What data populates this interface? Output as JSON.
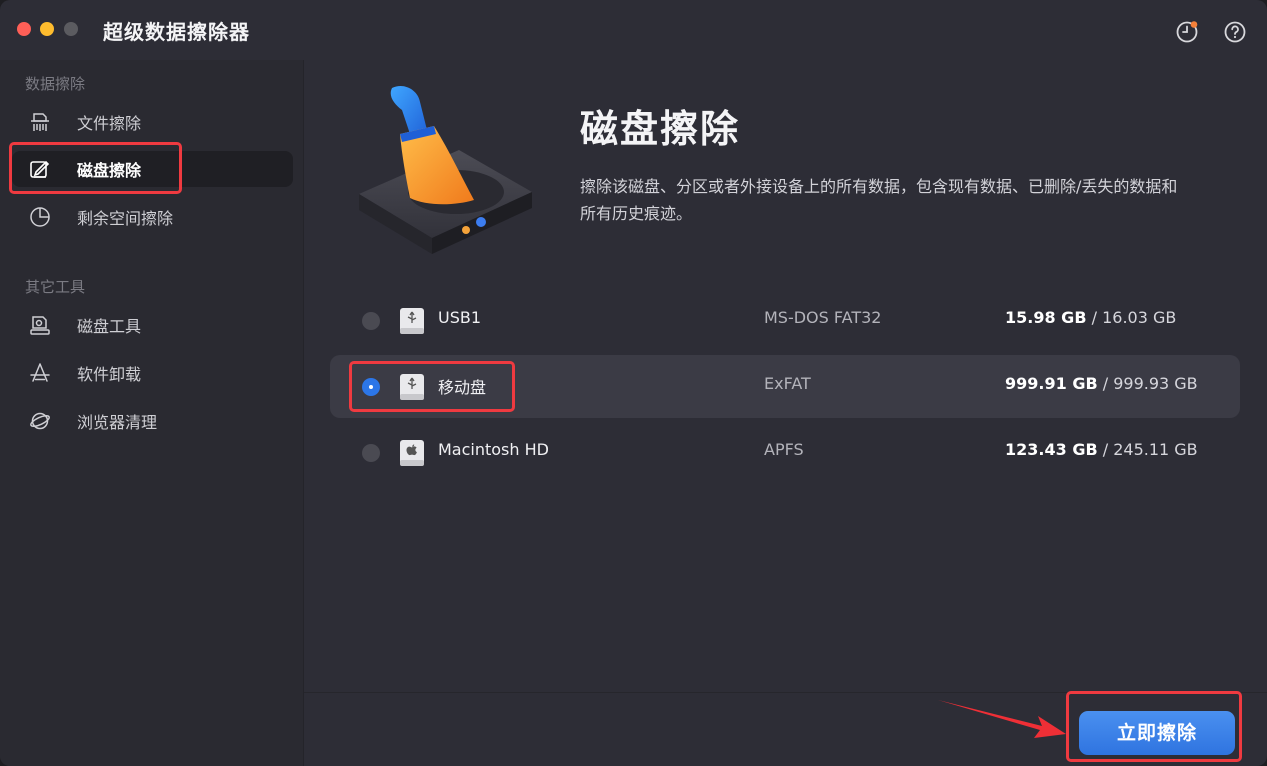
{
  "app": {
    "title": "超级数据擦除器"
  },
  "sidebar": {
    "sections": [
      {
        "label": "数据擦除"
      },
      {
        "label": "其它工具"
      }
    ],
    "items": [
      {
        "label": "文件擦除",
        "icon": "shredder-icon"
      },
      {
        "label": "磁盘擦除",
        "icon": "disk-erase-icon",
        "active": true
      },
      {
        "label": "剩余空间擦除",
        "icon": "pie-chart-icon"
      },
      {
        "label": "磁盘工具",
        "icon": "disk-tool-icon"
      },
      {
        "label": "软件卸载",
        "icon": "uninstall-icon"
      },
      {
        "label": "浏览器清理",
        "icon": "browser-icon"
      }
    ]
  },
  "main": {
    "title": "磁盘擦除",
    "description": "擦除该磁盘、分区或者外接设备上的所有数据，包含现有数据、已删除/丢失的数据和所有历史痕迹。",
    "drives": [
      {
        "name": "USB1",
        "filesystem": "MS-DOS FAT32",
        "free": "15.98 GB",
        "total": " / 16.03 GB",
        "selected": false,
        "icon": "usb-drive-icon"
      },
      {
        "name": "移动盘",
        "filesystem": "ExFAT",
        "free": "999.91 GB",
        "total": " / 999.93 GB",
        "selected": true,
        "icon": "usb-drive-icon"
      },
      {
        "name": "Macintosh HD",
        "filesystem": "APFS",
        "free": "123.43 GB",
        "total": " / 245.11 GB",
        "selected": false,
        "icon": "apple-drive-icon"
      }
    ],
    "erase_button": "立即擦除"
  },
  "colors": {
    "accent": "#2f74e0",
    "highlight": "#ef3a40",
    "background": "#2d2d36",
    "sidebar": "#2a2a31"
  }
}
